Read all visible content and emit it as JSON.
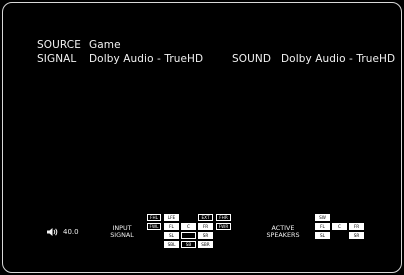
{
  "status": {
    "source_label": "SOURCE",
    "source_value": "Game",
    "signal_label": "SIGNAL",
    "signal_value": "Dolby Audio - TrueHD",
    "sound_label": "SOUND",
    "sound_value": "Dolby Audio - TrueHD"
  },
  "volume": {
    "icon": "speaker-icon",
    "value": "40.0"
  },
  "input_signal": {
    "label_line1": "INPUT",
    "label_line2": "SIGNAL",
    "channels": {
      "fhl": "FHL",
      "lfe": "LFE",
      "ext": "EXT",
      "fhr": "FHR",
      "fwl": "FWL",
      "fwr": "FWR",
      "fl": "FL",
      "c": "C",
      "fr": "FR",
      "sl": "SL",
      "sr": "SR",
      "sbl": "SBL",
      "sb": "SB",
      "sbr": "SBR"
    }
  },
  "active_speakers": {
    "label_line1": "ACTIVE",
    "label_line2": "SPEAKERS",
    "channels": {
      "sw": "SW",
      "fl": "FL",
      "c": "C",
      "fr": "FR",
      "sl": "SL",
      "sr": "SR"
    }
  },
  "colors": {
    "background": "#000000",
    "text": "#f2f2f2",
    "indicator": "#ffffff"
  }
}
